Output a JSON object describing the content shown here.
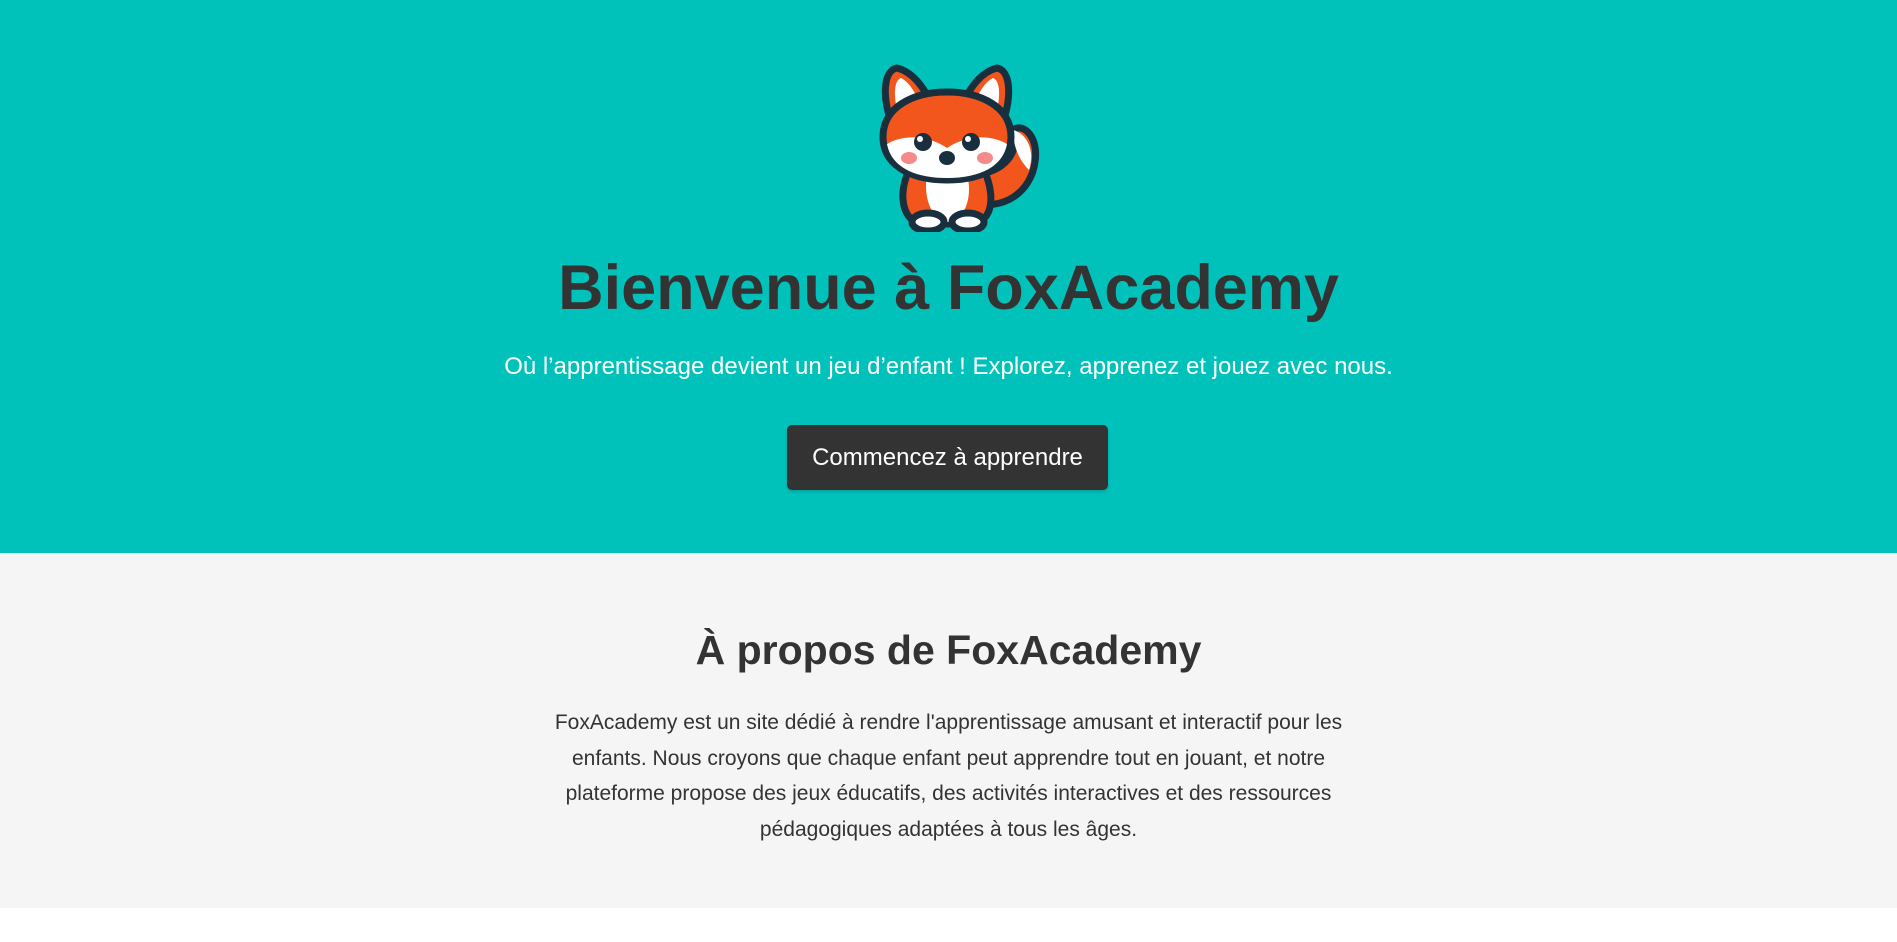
{
  "hero": {
    "title": "Bienvenue à FoxAcademy",
    "subtitle": "Où l’apprentissage devient un jeu d’enfant ! Explorez, apprenez et jouez avec nous.",
    "cta_label": "Commencez à apprendre",
    "logo_icon": "fox-mascot-icon"
  },
  "about": {
    "title": "À propos de FoxAcademy",
    "text": "FoxAcademy est un site dédié à rendre l'apprentissage amusant et interactif pour les enfants. Nous croyons que chaque enfant peut apprendre tout en jouant, et notre plateforme propose des jeux éducatifs, des activités interactives et des ressources pédagogiques adaptées à tous les âges."
  },
  "colors": {
    "hero_background": "#00c2bb",
    "about_background": "#f5f5f5",
    "button_background": "#333333",
    "text_dark": "#333333",
    "fox_orange": "#f2561d"
  }
}
